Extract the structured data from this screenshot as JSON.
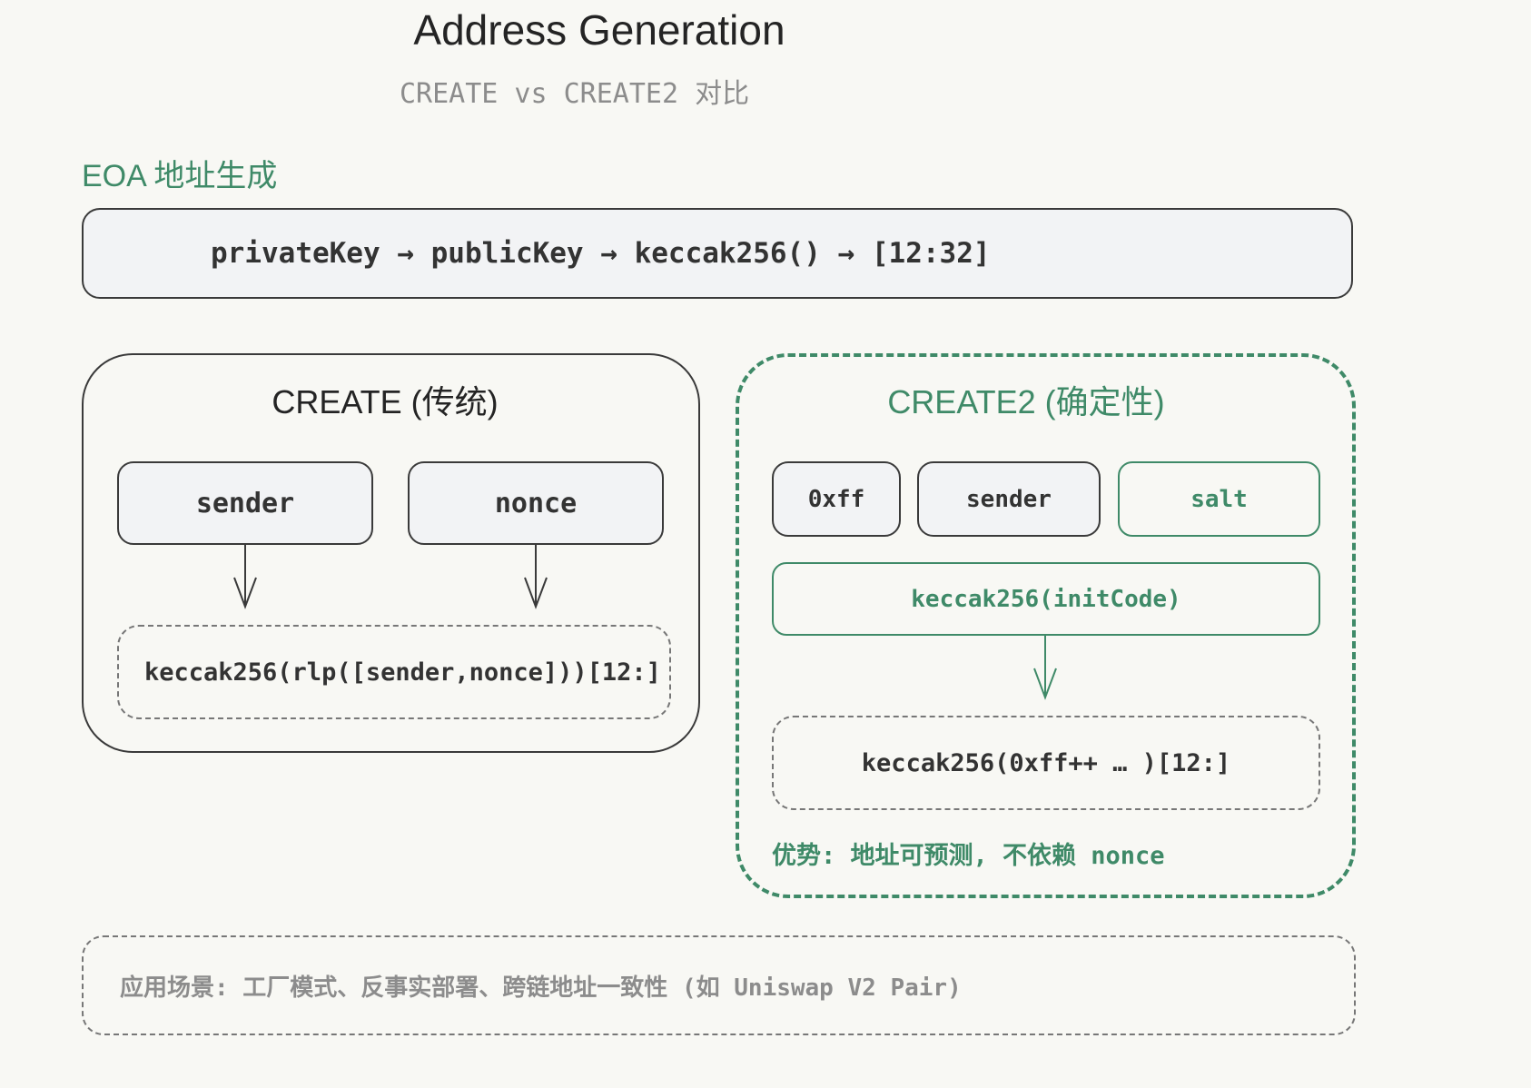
{
  "title": "Address Generation",
  "subtitle": "CREATE vs CREATE2 对比",
  "eoa": {
    "heading": "EOA 地址生成",
    "flow": "privateKey → publicKey → keccak256() → [12:32]"
  },
  "create": {
    "title": "CREATE (传统)",
    "inputs": [
      "sender",
      "nonce"
    ],
    "result": "keccak256(rlp([sender,nonce]))[12:]"
  },
  "create2": {
    "title": "CREATE2 (确定性)",
    "inputs": [
      "0xff",
      "sender",
      "salt"
    ],
    "init_code": "keccak256(initCode)",
    "result": "keccak256(0xff++ … )[12:]",
    "advantage": "优势: 地址可预测, 不依赖 nonce"
  },
  "use_cases": "应用场景: 工厂模式、反事实部署、跨链地址一致性 (如 Uniswap V2 Pair)",
  "colors": {
    "accent_green": "#3f8a68",
    "box_fill": "#f2f3f5",
    "background": "#f8f8f4"
  }
}
